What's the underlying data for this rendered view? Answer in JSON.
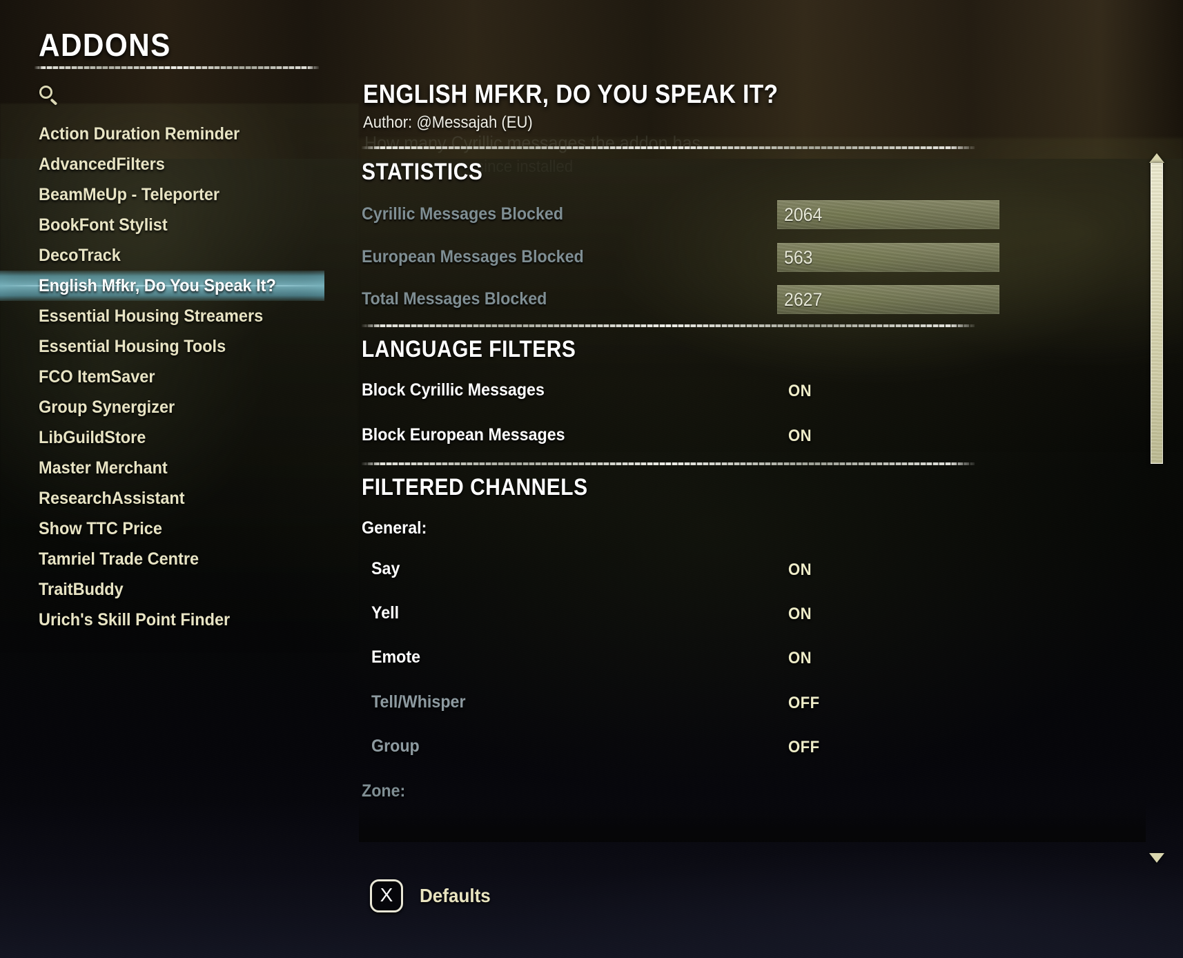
{
  "window": {
    "title": "ADDONS"
  },
  "search": {
    "icon": "search-icon",
    "value": "",
    "placeholder": ""
  },
  "sidebar": {
    "items": [
      {
        "label": "Action Duration Reminder",
        "selected": false
      },
      {
        "label": "AdvancedFilters",
        "selected": false
      },
      {
        "label": "BeamMeUp - Teleporter",
        "selected": false
      },
      {
        "label": "BookFont Stylist",
        "selected": false
      },
      {
        "label": "DecoTrack",
        "selected": false
      },
      {
        "label": "English Mfkr, Do You Speak It?",
        "selected": true
      },
      {
        "label": "Essential Housing Streamers",
        "selected": false
      },
      {
        "label": "Essential Housing Tools",
        "selected": false
      },
      {
        "label": "FCO ItemSaver",
        "selected": false
      },
      {
        "label": "Group Synergizer",
        "selected": false
      },
      {
        "label": "LibGuildStore",
        "selected": false
      },
      {
        "label": "Master Merchant",
        "selected": false
      },
      {
        "label": "ResearchAssistant",
        "selected": false
      },
      {
        "label": "Show TTC Price",
        "selected": false
      },
      {
        "label": "Tamriel Trade Centre",
        "selected": false
      },
      {
        "label": "TraitBuddy",
        "selected": false
      },
      {
        "label": "Urich's Skill Point Finder",
        "selected": false
      }
    ]
  },
  "panel": {
    "title": "ENGLISH MFKR, DO YOU SPEAK IT?",
    "author": "Author: @Messajah (EU)",
    "tooltip_ghost": "How many Cyrillic messages the addon has",
    "tooltip_ghost_2": "since installed",
    "statistics": {
      "heading": "STATISTICS",
      "rows": [
        {
          "label": "Cyrillic Messages Blocked",
          "value": "2064"
        },
        {
          "label": "European Messages Blocked",
          "value": "563"
        },
        {
          "label": "Total Messages Blocked",
          "value": "2627"
        }
      ]
    },
    "language_filters": {
      "heading": "LANGUAGE FILTERS",
      "rows": [
        {
          "label": "Block Cyrillic Messages",
          "value": "ON",
          "dim": false
        },
        {
          "label": "Block European Messages",
          "value": "ON",
          "dim": false
        }
      ]
    },
    "filtered_channels": {
      "heading": "FILTERED CHANNELS",
      "groups": [
        {
          "name": "General:",
          "dim": false,
          "rows": [
            {
              "label": "Say",
              "value": "ON",
              "dim": false
            },
            {
              "label": "Yell",
              "value": "ON",
              "dim": false
            },
            {
              "label": "Emote",
              "value": "ON",
              "dim": false
            },
            {
              "label": "Tell/Whisper",
              "value": "OFF",
              "dim": true
            },
            {
              "label": "Group",
              "value": "OFF",
              "dim": true
            }
          ]
        },
        {
          "name": "Zone:",
          "dim": true,
          "rows": []
        }
      ]
    }
  },
  "footer": {
    "keybind": "X",
    "defaults_label": "Defaults"
  },
  "scrollbar": {
    "up_icon": "chevron-up-icon",
    "down_icon": "chevron-down-icon"
  },
  "colors": {
    "accent_selected": "#96e1f2",
    "list_text": "#e8e4c4",
    "value_text": "#eeecc8",
    "dim_text": "#7f8e93",
    "stat_field_bg": "#bcc096"
  }
}
